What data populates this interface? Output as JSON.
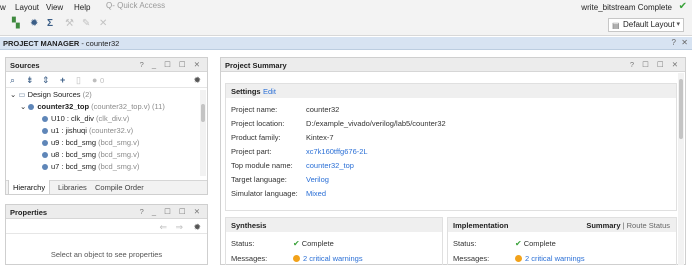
{
  "menu": {
    "items": [
      "w",
      "Layout",
      "View",
      "Help"
    ],
    "quick_access_placeholder": "Q- Quick Access",
    "status_text": "write_bitstream Complete"
  },
  "toolbar": {
    "icons": [
      "hierarchy-icon",
      "gear-icon",
      "sigma-icon",
      "hammer-icon",
      "wrench-icon",
      "close-x-icon"
    ],
    "layout_label": "Default Layout"
  },
  "project_manager": {
    "title_bold": "PROJECT MANAGER",
    "title_rest": " - counter32",
    "help": "?",
    "close": "✕"
  },
  "sources": {
    "title": "Sources",
    "controls": "? _ ☐ ☐ ✕",
    "badge_count": "0",
    "tree": {
      "group_label": "Design Sources",
      "group_count": "(2)",
      "top_name": "counter32_top",
      "top_meta": "(counter32_top.v) (11)",
      "children": [
        {
          "name": "U10 : clk_div",
          "meta": "(clk_div.v)"
        },
        {
          "name": "u1 : jishuqi",
          "meta": "(counter32.v)"
        },
        {
          "name": "u9 : bcd_smg",
          "meta": "(bcd_smg.v)"
        },
        {
          "name": "u8 : bcd_smg",
          "meta": "(bcd_smg.v)"
        },
        {
          "name": "u7 : bcd_smg",
          "meta": "(bcd_smg.v)"
        }
      ]
    },
    "tabs": [
      "Hierarchy",
      "Libraries",
      "Compile Order"
    ]
  },
  "properties": {
    "title": "Properties",
    "controls": "? _ ☐ ☐ ✕",
    "empty_message": "Select an object to see properties"
  },
  "summary": {
    "title": "Project Summary",
    "controls": "? ☐ ☐ ✕",
    "settings": {
      "title": "Settings",
      "edit": "Edit",
      "rows": [
        {
          "label": "Project name:",
          "value": "counter32",
          "link": false
        },
        {
          "label": "Project location:",
          "value": "D:/example_vivado/verilog/lab5/counter32",
          "link": false
        },
        {
          "label": "Product family:",
          "value": "Kintex-7",
          "link": false
        },
        {
          "label": "Project part:",
          "value": "xc7k160tffg676-2L",
          "link": true
        },
        {
          "label": "Top module name:",
          "value": "counter32_top",
          "link": true
        },
        {
          "label": "Target language:",
          "value": "Verilog",
          "link": true
        },
        {
          "label": "Simulator language:",
          "value": "Mixed",
          "link": true
        }
      ]
    },
    "synthesis": {
      "title": "Synthesis",
      "status_label": "Status:",
      "status_value": "Complete",
      "messages_label": "Messages:",
      "messages_value": "2 critical warnings"
    },
    "implementation": {
      "title": "Implementation",
      "link_summary": "Summary",
      "link_sep": "|",
      "link_route": "Route Status",
      "status_label": "Status:",
      "status_value": "Complete",
      "messages_label": "Messages:",
      "messages_value": "2 critical warnings"
    }
  },
  "colors": {
    "accent_blue": "#2a6fd6",
    "pm_bar": "#d7e3f2",
    "success_green": "#3aa23a",
    "warning_orange": "#f2a21a"
  }
}
